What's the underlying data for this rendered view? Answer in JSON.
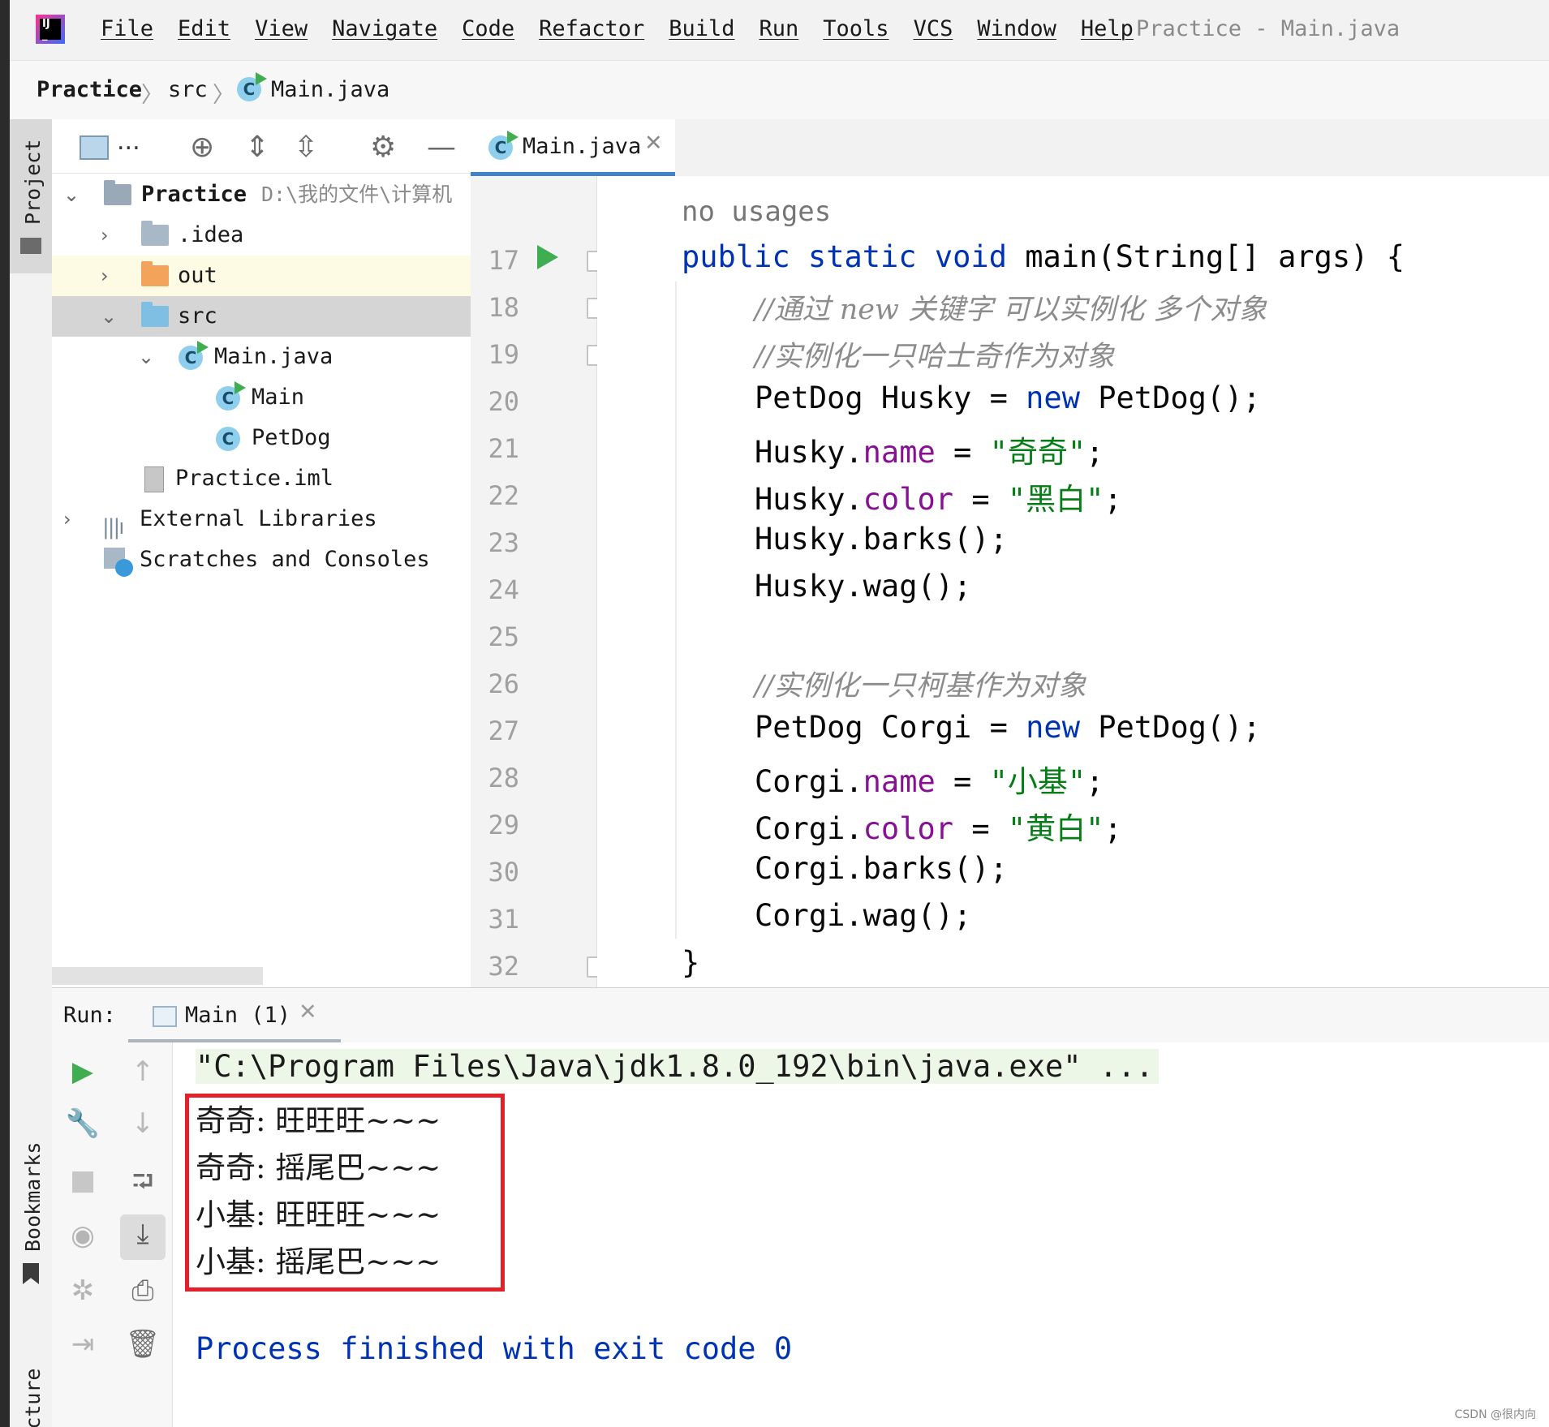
{
  "menubar": {
    "items": [
      "File",
      "Edit",
      "View",
      "Navigate",
      "Code",
      "Refactor",
      "Build",
      "Run",
      "Tools",
      "VCS",
      "Window",
      "Help"
    ],
    "window_title": "Practice - Main.java"
  },
  "breadcrumb": {
    "project": "Practice",
    "folder": "src",
    "file": "Main.java"
  },
  "left_strip": {
    "project_tab": "Project",
    "bookmarks_tab": "Bookmarks",
    "structure_tab": "Structure"
  },
  "project_tree": {
    "toolbar_ellipsis": "...",
    "root": {
      "label": "Practice",
      "path": "D:\\我的文件\\计算机"
    },
    "idea": ".idea",
    "out": "out",
    "src": "src",
    "main_java": "Main.java",
    "main_class": "Main",
    "petdog_class": "PetDog",
    "iml": "Practice.iml",
    "external": "External Libraries",
    "scratches": "Scratches and Consoles"
  },
  "editor": {
    "tab_label": "Main.java",
    "hint": "no usages",
    "line_numbers": [
      "17",
      "18",
      "19",
      "20",
      "21",
      "22",
      "23",
      "24",
      "25",
      "26",
      "27",
      "28",
      "29",
      "30",
      "31",
      "32"
    ],
    "lines": {
      "l17": {
        "kw": "public static void",
        "rest": " main(String[] args) {"
      },
      "l18": "//通过 new 关键字 可以实例化 多个对象",
      "l19": "//实例化一只哈士奇作为对象",
      "l20": {
        "a": "PetDog Husky = ",
        "kw": "new",
        "b": " PetDog();"
      },
      "l21": {
        "obj": "Husky.",
        "fld": "name",
        "eq": " = ",
        "str": "\"奇奇\"",
        "end": ";"
      },
      "l22": {
        "obj": "Husky.",
        "fld": "color",
        "eq": " = ",
        "str": "\"黑白\"",
        "end": ";"
      },
      "l23": "Husky.barks();",
      "l24": "Husky.wag();",
      "l26": "//实例化一只柯基作为对象",
      "l27": {
        "a": "PetDog Corgi = ",
        "kw": "new",
        "b": " PetDog();"
      },
      "l28": {
        "obj": "Corgi.",
        "fld": "name",
        "eq": " = ",
        "str": "\"小基\"",
        "end": ";"
      },
      "l29": {
        "obj": "Corgi.",
        "fld": "color",
        "eq": " = ",
        "str": "\"黄白\"",
        "end": ";"
      },
      "l30": "Corgi.barks();",
      "l31": "Corgi.wag();",
      "l32": "}"
    }
  },
  "run": {
    "label": "Run:",
    "tab": "Main (1)",
    "command": "\"C:\\Program Files\\Java\\jdk1.8.0_192\\bin\\java.exe\" ...",
    "output": [
      "奇奇: 旺旺旺~~~",
      "奇奇: 摇尾巴~~~",
      "小基: 旺旺旺~~~",
      "小基: 摇尾巴~~~"
    ],
    "finished": "Process finished with exit code 0"
  },
  "watermark": "CSDN @很内向",
  "colors": {
    "keyword": "#0033b3",
    "field": "#871094",
    "string": "#067d17",
    "comment": "#8c8c8c",
    "highlight_box": "#e2212b"
  }
}
